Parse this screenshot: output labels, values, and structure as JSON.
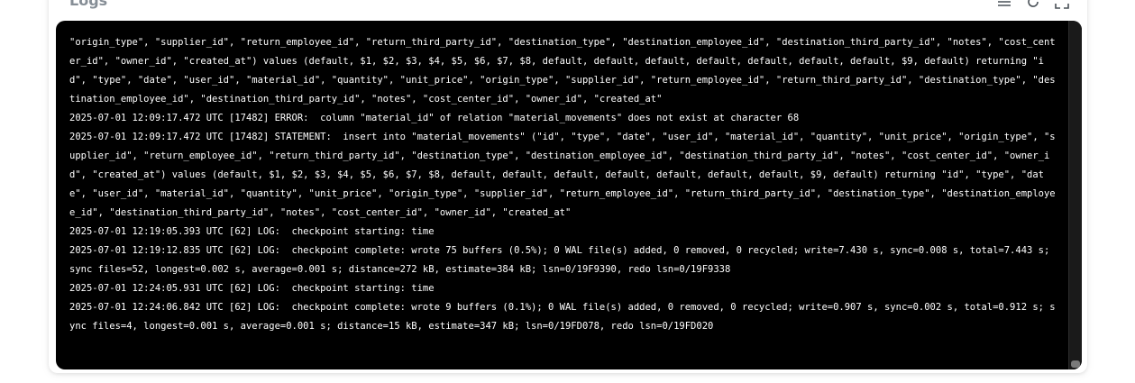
{
  "panel": {
    "title": "Logs"
  },
  "toolbar": {
    "icons": [
      "list-icon",
      "refresh-icon",
      "expand-icon"
    ]
  },
  "colors": {
    "terminal_bg": "#000000",
    "log_text": "#ffffff",
    "title_text": "#868e96"
  },
  "logs": [
    "\"origin_type\", \"supplier_id\", \"return_employee_id\", \"return_third_party_id\", \"destination_type\", \"destination_employee_id\", \"destination_third_party_id\", \"notes\", \"cost_center_id\", \"owner_id\", \"created_at\") values (default, $1, $2, $3, $4, $5, $6, $7, $8, default, default, default, default, default, default, default, $9, default) returning \"id\", \"type\", \"date\", \"user_id\", \"material_id\", \"quantity\", \"unit_price\", \"origin_type\", \"supplier_id\", \"return_employee_id\", \"return_third_party_id\", \"destination_type\", \"destination_employee_id\", \"destination_third_party_id\", \"notes\", \"cost_center_id\", \"owner_id\", \"created_at\"",
    "2025-07-01 12:09:17.472 UTC [17482] ERROR:  column \"material_id\" of relation \"material_movements\" does not exist at character 68",
    "2025-07-01 12:09:17.472 UTC [17482] STATEMENT:  insert into \"material_movements\" (\"id\", \"type\", \"date\", \"user_id\", \"material_id\", \"quantity\", \"unit_price\", \"origin_type\", \"supplier_id\", \"return_employee_id\", \"return_third_party_id\", \"destination_type\", \"destination_employee_id\", \"destination_third_party_id\", \"notes\", \"cost_center_id\", \"owner_id\", \"created_at\") values (default, $1, $2, $3, $4, $5, $6, $7, $8, default, default, default, default, default, default, default, $9, default) returning \"id\", \"type\", \"date\", \"user_id\", \"material_id\", \"quantity\", \"unit_price\", \"origin_type\", \"supplier_id\", \"return_employee_id\", \"return_third_party_id\", \"destination_type\", \"destination_employee_id\", \"destination_third_party_id\", \"notes\", \"cost_center_id\", \"owner_id\", \"created_at\"",
    "2025-07-01 12:19:05.393 UTC [62] LOG:  checkpoint starting: time",
    "2025-07-01 12:19:12.835 UTC [62] LOG:  checkpoint complete: wrote 75 buffers (0.5%); 0 WAL file(s) added, 0 removed, 0 recycled; write=7.430 s, sync=0.008 s, total=7.443 s; sync files=52, longest=0.002 s, average=0.001 s; distance=272 kB, estimate=384 kB; lsn=0/19F9390, redo lsn=0/19F9338",
    "2025-07-01 12:24:05.931 UTC [62] LOG:  checkpoint starting: time",
    "2025-07-01 12:24:06.842 UTC [62] LOG:  checkpoint complete: wrote 9 buffers (0.1%); 0 WAL file(s) added, 0 removed, 0 recycled; write=0.907 s, sync=0.002 s, total=0.912 s; sync files=4, longest=0.001 s, average=0.001 s; distance=15 kB, estimate=347 kB; lsn=0/19FD078, redo lsn=0/19FD020"
  ]
}
